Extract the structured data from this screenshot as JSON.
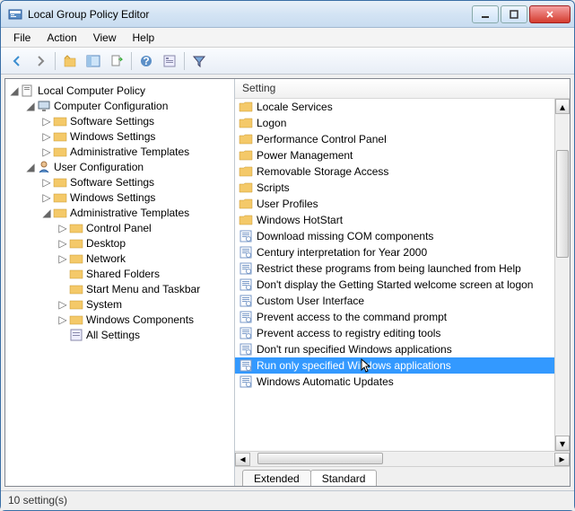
{
  "window": {
    "title": "Local Group Policy Editor"
  },
  "menu": {
    "file": "File",
    "action": "Action",
    "view": "View",
    "help": "Help"
  },
  "tree": {
    "root": "Local Computer Policy",
    "comp_config": "Computer Configuration",
    "comp_sw": "Software Settings",
    "comp_win": "Windows Settings",
    "comp_admin": "Administrative Templates",
    "user_config": "User Configuration",
    "user_sw": "Software Settings",
    "user_win": "Windows Settings",
    "user_admin": "Administrative Templates",
    "ctrl_panel": "Control Panel",
    "desktop": "Desktop",
    "network": "Network",
    "shared": "Shared Folders",
    "startmenu": "Start Menu and Taskbar",
    "system": "System",
    "wincomp": "Windows Components",
    "allset": "All Settings"
  },
  "list": {
    "header": "Setting",
    "items": [
      {
        "icon": "folder",
        "label": "Locale Services"
      },
      {
        "icon": "folder",
        "label": "Logon"
      },
      {
        "icon": "folder",
        "label": "Performance Control Panel"
      },
      {
        "icon": "folder",
        "label": "Power Management"
      },
      {
        "icon": "folder",
        "label": "Removable Storage Access"
      },
      {
        "icon": "folder",
        "label": "Scripts"
      },
      {
        "icon": "folder",
        "label": "User Profiles"
      },
      {
        "icon": "folder",
        "label": "Windows HotStart"
      },
      {
        "icon": "setting",
        "label": "Download missing COM components"
      },
      {
        "icon": "setting",
        "label": "Century interpretation for Year 2000"
      },
      {
        "icon": "setting",
        "label": "Restrict these programs from being launched from Help"
      },
      {
        "icon": "setting",
        "label": "Don't display the Getting Started welcome screen at logon"
      },
      {
        "icon": "setting",
        "label": "Custom User Interface"
      },
      {
        "icon": "setting",
        "label": "Prevent access to the command prompt"
      },
      {
        "icon": "setting",
        "label": "Prevent access to registry editing tools"
      },
      {
        "icon": "setting",
        "label": "Don't run specified Windows applications"
      },
      {
        "icon": "setting",
        "label": "Run only specified Windows applications",
        "selected": true
      },
      {
        "icon": "setting",
        "label": "Windows Automatic Updates"
      }
    ]
  },
  "tabs": {
    "extended": "Extended",
    "standard": "Standard"
  },
  "status": {
    "text": "10 setting(s)"
  }
}
